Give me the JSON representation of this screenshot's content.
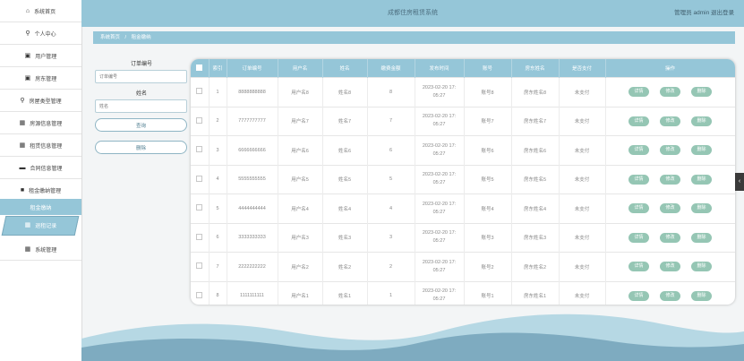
{
  "sidebar": {
    "items": [
      {
        "label": "系统首页",
        "icon": "home-icon"
      },
      {
        "label": "个人中心",
        "icon": "person-icon"
      },
      {
        "label": "用户管理",
        "icon": "folder-icon"
      },
      {
        "label": "房东管理",
        "icon": "folder-icon"
      },
      {
        "label": "房屋类型管理",
        "icon": "person-icon"
      },
      {
        "label": "房源信息管理",
        "icon": "grid-icon"
      },
      {
        "label": "租赁信息管理",
        "icon": "grid-icon"
      },
      {
        "label": "合同信息管理",
        "icon": "card-icon"
      },
      {
        "label": "租金缴纳管理",
        "icon": "chat-icon"
      }
    ],
    "active_group": "租金缴纳",
    "active_sub": "退租记录",
    "last_item": "系统管理"
  },
  "header": {
    "title": "成都住房租赁系统",
    "user_text": "管理员 admin  退出登录"
  },
  "breadcrumb": {
    "home": "系统首页",
    "sep": "/",
    "current": "租金缴纳"
  },
  "search": {
    "order_label": "订单编号",
    "order_placeholder": "订单编号",
    "name_label": "姓名",
    "name_placeholder": "姓名",
    "query_button": "查询",
    "delete_button": "删除"
  },
  "table": {
    "headers": [
      "索引",
      "订单编号",
      "用户名",
      "姓名",
      "缴费金额",
      "发布时间",
      "账号",
      "房东姓名",
      "是否支付",
      "操作"
    ],
    "rows": [
      {
        "index": "1",
        "order": "8888888888",
        "username": "用户名8",
        "name": "姓名8",
        "amount": "8",
        "time1": "2023-02-20 17:",
        "time2": "05:27",
        "account": "账号8",
        "landlord": "房东姓名8",
        "paid": "未支付"
      },
      {
        "index": "2",
        "order": "7777777777",
        "username": "用户名7",
        "name": "姓名7",
        "amount": "7",
        "time1": "2023-02-20 17:",
        "time2": "05:27",
        "account": "账号7",
        "landlord": "房东姓名7",
        "paid": "未支付"
      },
      {
        "index": "3",
        "order": "6666666666",
        "username": "用户名6",
        "name": "姓名6",
        "amount": "6",
        "time1": "2023-02-20 17:",
        "time2": "05:27",
        "account": "账号6",
        "landlord": "房东姓名6",
        "paid": "未支付"
      },
      {
        "index": "4",
        "order": "5555555555",
        "username": "用户名5",
        "name": "姓名5",
        "amount": "5",
        "time1": "2023-02-20 17:",
        "time2": "05:27",
        "account": "账号5",
        "landlord": "房东姓名5",
        "paid": "未支付"
      },
      {
        "index": "5",
        "order": "4444444444",
        "username": "用户名4",
        "name": "姓名4",
        "amount": "4",
        "time1": "2023-02-20 17:",
        "time2": "05:27",
        "account": "账号4",
        "landlord": "房东姓名4",
        "paid": "未支付"
      },
      {
        "index": "6",
        "order": "3333333333",
        "username": "用户名3",
        "name": "姓名3",
        "amount": "3",
        "time1": "2023-02-20 17:",
        "time2": "05:27",
        "account": "账号3",
        "landlord": "房东姓名3",
        "paid": "未支付"
      },
      {
        "index": "7",
        "order": "2222222222",
        "username": "用户名2",
        "name": "姓名2",
        "amount": "2",
        "time1": "2023-02-20 17:",
        "time2": "05:27",
        "account": "账号2",
        "landlord": "房东姓名2",
        "paid": "未支付"
      },
      {
        "index": "8",
        "order": "1111111111",
        "username": "用户名1",
        "name": "姓名1",
        "amount": "1",
        "time1": "2023-02-20 17:",
        "time2": "05:27",
        "account": "账号1",
        "landlord": "房东姓名1",
        "paid": "未支付"
      }
    ],
    "actions": {
      "detail": "详情",
      "edit": "修改",
      "delete": "删除"
    }
  },
  "side_tab": "‹",
  "colors": {
    "accent": "#95c6d8",
    "action_button": "#95c6b4",
    "wave_dark": "#6e9fb5",
    "wave_light": "#a9d1df"
  }
}
